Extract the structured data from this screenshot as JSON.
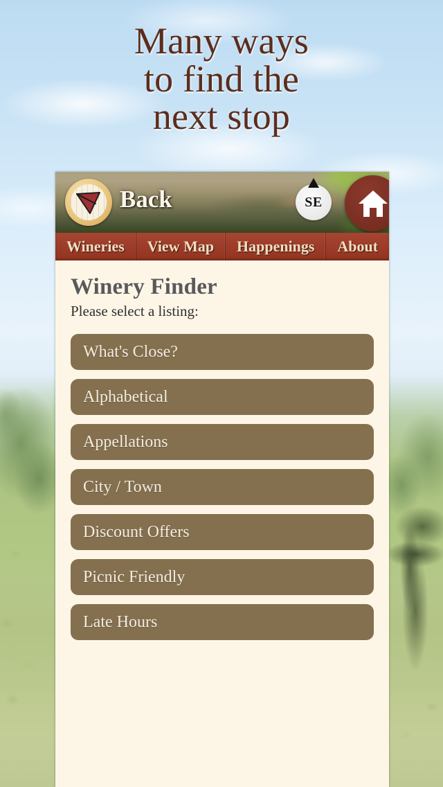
{
  "headline": {
    "lines": [
      "Many ways",
      "to find the",
      "next stop"
    ],
    "color": "#5c2d1c"
  },
  "app": {
    "header": {
      "logo_icon": "wine-glass-compass-logo",
      "back_label": "Back",
      "compass": {
        "direction": "SE",
        "needle_icon": "compass-needle-triangle"
      },
      "home_icon": "home-icon"
    },
    "nav": {
      "items": [
        {
          "label": "Wineries"
        },
        {
          "label": "View Map"
        },
        {
          "label": "Happenings"
        },
        {
          "label": "About"
        }
      ],
      "background_color": "#9d3c2a",
      "text_color": "#f3dfc0"
    },
    "content": {
      "title": "Winery Finder",
      "subtitle": "Please select a listing:",
      "background_color": "#fdf6e6",
      "title_color": "#59595c",
      "buttons": [
        {
          "label": "What's Close?"
        },
        {
          "label": "Alphabetical"
        },
        {
          "label": "Appellations"
        },
        {
          "label": "City / Town"
        },
        {
          "label": "Discount Offers"
        },
        {
          "label": "Picnic Friendly"
        },
        {
          "label": "Late Hours"
        }
      ],
      "button_color": "#84704f",
      "button_text_color": "#f2ece0"
    }
  }
}
